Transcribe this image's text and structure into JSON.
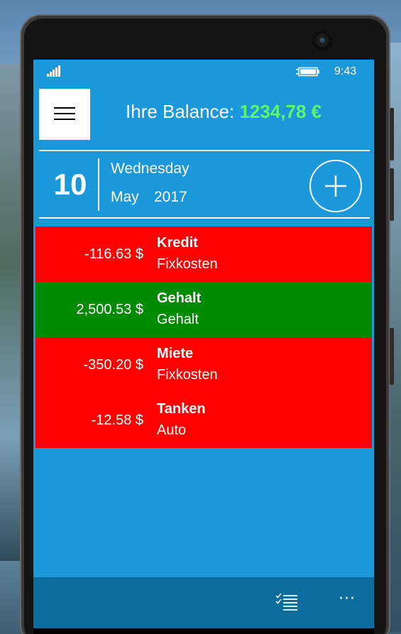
{
  "status": {
    "time": "9:43"
  },
  "header": {
    "balance_label": "Ihre Balance:",
    "balance_value": "1234,78 €",
    "balance_color": "#5cf86a"
  },
  "date": {
    "day": "10",
    "weekday": "Wednesday",
    "month": "May",
    "year": "2017"
  },
  "transactions": [
    {
      "amount": "-116.63 $",
      "title": "Kredit",
      "category": "Fixkosten",
      "color": "#ff0000"
    },
    {
      "amount": "2,500.53 $",
      "title": "Gehalt",
      "category": "Gehalt",
      "color": "#008a00"
    },
    {
      "amount": "-350.20 $",
      "title": "Miete",
      "category": "Fixkosten",
      "color": "#ff0000"
    },
    {
      "amount": "-12.58 $",
      "title": "Tanken",
      "category": "Auto",
      "color": "#ff0000"
    }
  ],
  "appbar": {
    "icons": [
      "list-icon",
      "more-icon"
    ],
    "more_glyph": "···"
  },
  "icons": {
    "menu": "hamburger-icon",
    "add": "plus-icon",
    "signal": "signal-icon",
    "battery": "battery-icon"
  },
  "colors": {
    "screen_bg": "#1b98d9",
    "appbar_bg": "#0c6d9d"
  }
}
